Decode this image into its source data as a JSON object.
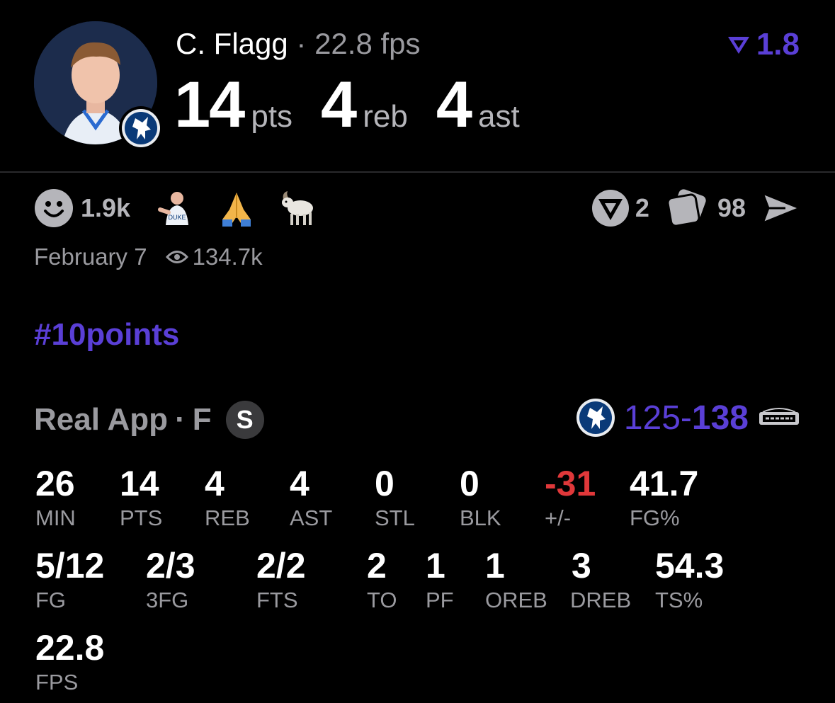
{
  "header": {
    "player_name": "C. Flagg",
    "separator": "·",
    "fps_text": "22.8 fps",
    "pts_value": "14",
    "pts_label": "pts",
    "reb_value": "4",
    "reb_label": "reb",
    "ast_value": "4",
    "ast_label": "ast",
    "rating_value": "1.8",
    "rating_icon": "real-rating-icon"
  },
  "social": {
    "reaction_count": "1.9k",
    "emojis": [
      "player-reaction-icon",
      "praying-hands-icon",
      "goat-icon"
    ],
    "comments_count": "2",
    "cards_count": "98",
    "date": "February 7",
    "views": "134.7k"
  },
  "hashtag": "#10points",
  "game": {
    "source": "Real App",
    "dot": "·",
    "status": "F",
    "badge_letter": "S",
    "score_home": "125",
    "score_dash": "-",
    "score_away": "138",
    "home_team_icon": "mavericks-logo-icon",
    "away_team_icon": "spurs-logo-icon"
  },
  "stats_row1": [
    {
      "value": "26",
      "label": "MIN"
    },
    {
      "value": "14",
      "label": "PTS"
    },
    {
      "value": "4",
      "label": "REB"
    },
    {
      "value": "4",
      "label": "AST"
    },
    {
      "value": "0",
      "label": "STL"
    },
    {
      "value": "0",
      "label": "BLK"
    },
    {
      "value": "-31",
      "label": "+/-"
    },
    {
      "value": "41.7",
      "label": "FG%"
    }
  ],
  "stats_row2": [
    {
      "value": "5/12",
      "label": "FG"
    },
    {
      "value": "2/3",
      "label": "3FG"
    },
    {
      "value": "2/2",
      "label": "FTS"
    },
    {
      "value": "2",
      "label": "TO"
    },
    {
      "value": "1",
      "label": "PF"
    },
    {
      "value": "1",
      "label": "OREB"
    },
    {
      "value": "3",
      "label": "DREB"
    },
    {
      "value": "54.3",
      "label": "TS%"
    }
  ],
  "stats_row3": [
    {
      "value": "22.8",
      "label": "FPS"
    }
  ],
  "colors": {
    "accent": "#5a3fd6",
    "negative": "#e0383a",
    "muted": "#9a9a9f"
  }
}
